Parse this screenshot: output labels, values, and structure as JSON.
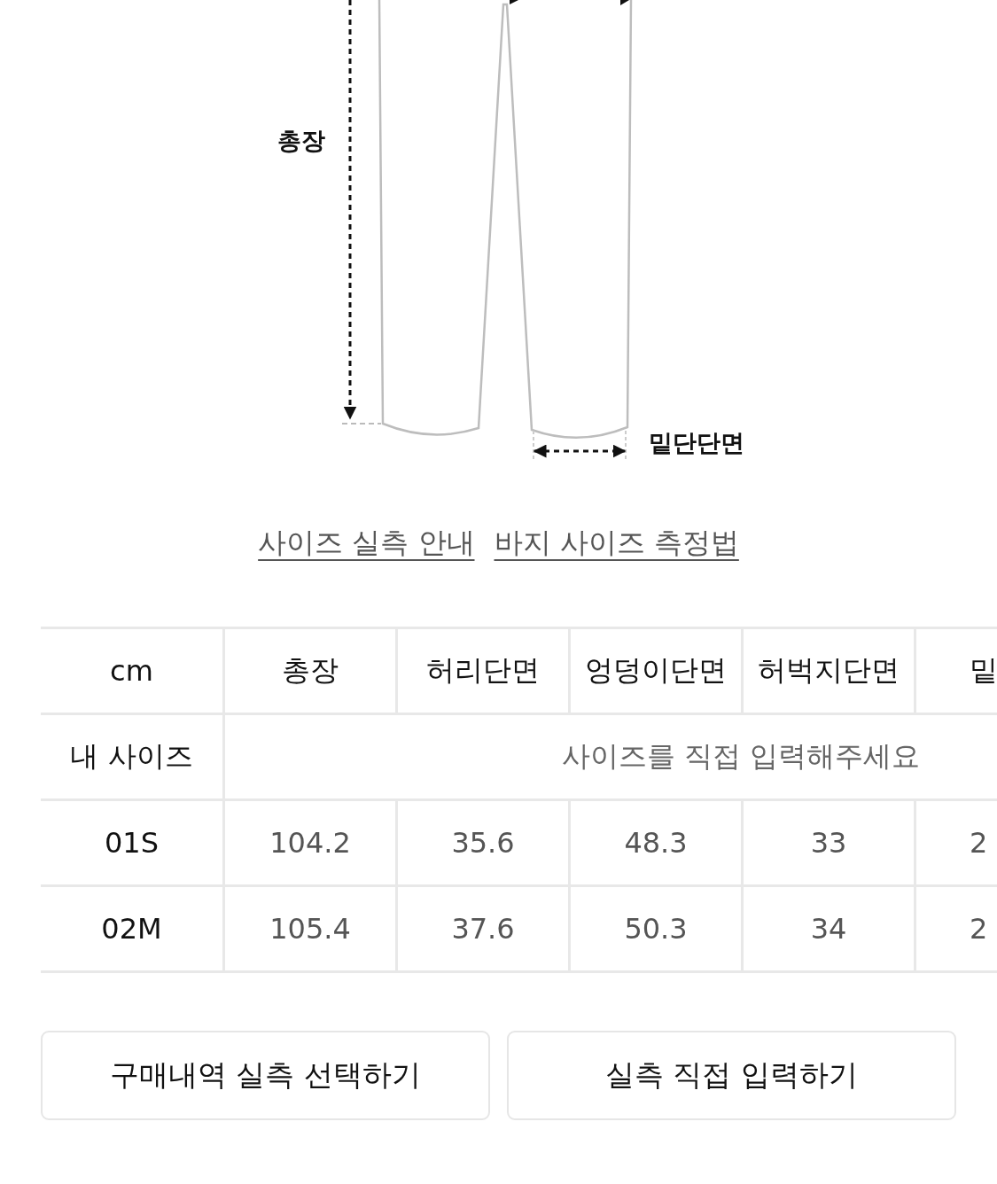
{
  "diagram": {
    "labels": [
      {
        "kind": "total_length",
        "text": "총장"
      },
      {
        "kind": "hem",
        "text": "밑단단면"
      }
    ]
  },
  "links": [
    "사이즈 실측 안내",
    "바지 사이즈 측정법"
  ],
  "table": {
    "columns": [
      "cm",
      "총장",
      "허리단면",
      "엉덩이단면",
      "허벅지단면",
      "밑"
    ],
    "my_size": {
      "label": "내 사이즈",
      "prompt": "사이즈를 직접 입력해주세요"
    },
    "rows": [
      {
        "size": "01S",
        "values": [
          "104.2",
          "35.6",
          "48.3",
          "33",
          "2"
        ]
      },
      {
        "size": "02M",
        "values": [
          "105.4",
          "37.6",
          "50.3",
          "34",
          "2"
        ]
      }
    ]
  },
  "buttons": [
    "구매내역 실측 선택하기",
    "실측 직접 입력하기"
  ]
}
